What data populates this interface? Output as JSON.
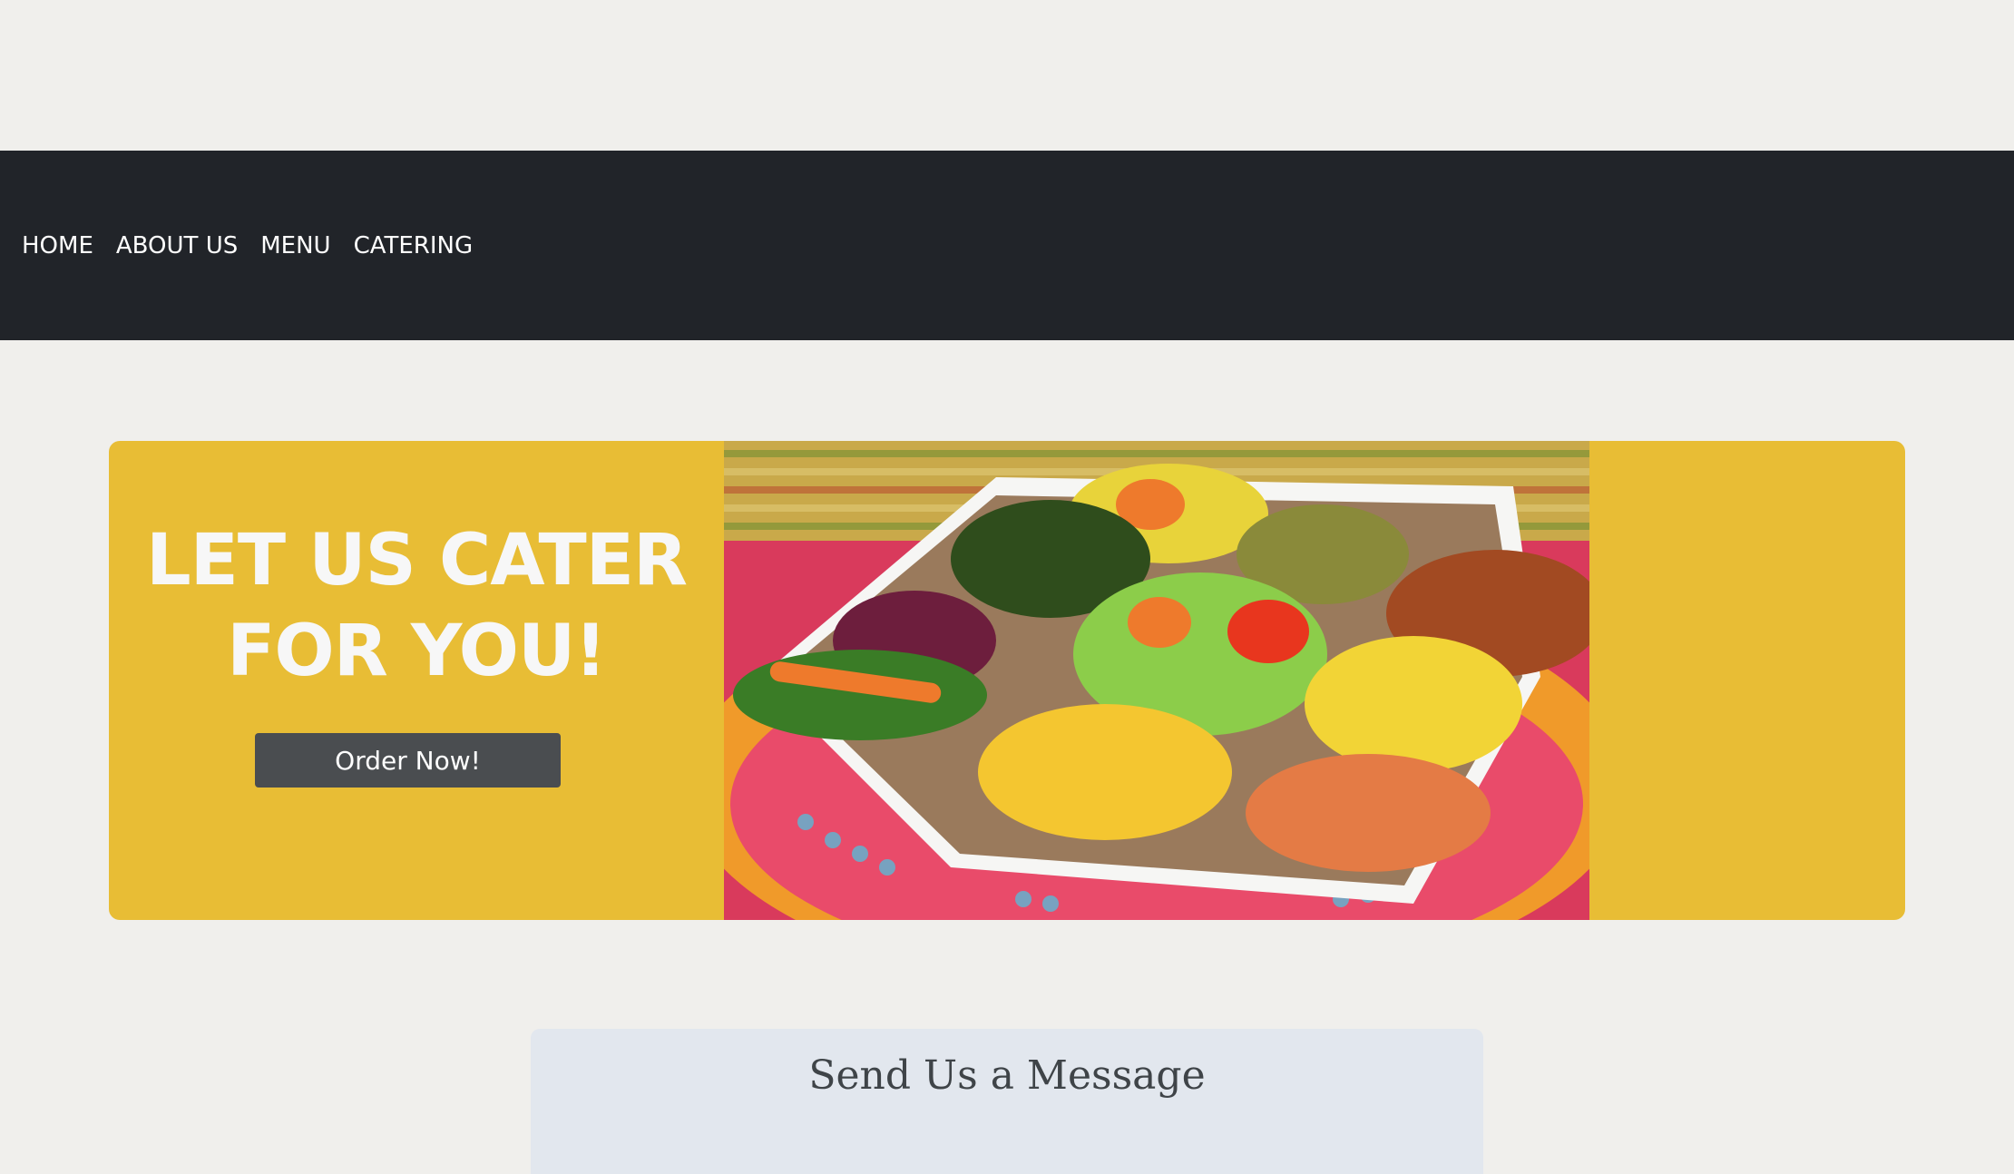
{
  "nav": {
    "items": [
      {
        "label": "HOME"
      },
      {
        "label": "ABOUT US"
      },
      {
        "label": "MENU"
      },
      {
        "label": "CATERING"
      }
    ]
  },
  "hero": {
    "title_line1": "LET US CATER",
    "title_line2": "FOR YOU!",
    "button_label": "Order Now!",
    "image_icon": "food-platter-image"
  },
  "contact": {
    "title": "Send Us a Message"
  },
  "colors": {
    "navbar": "#212429",
    "page_background": "#f0efec",
    "hero_background": "#e8bd35",
    "button": "#4a4d50",
    "card": "#e2e7ee"
  }
}
